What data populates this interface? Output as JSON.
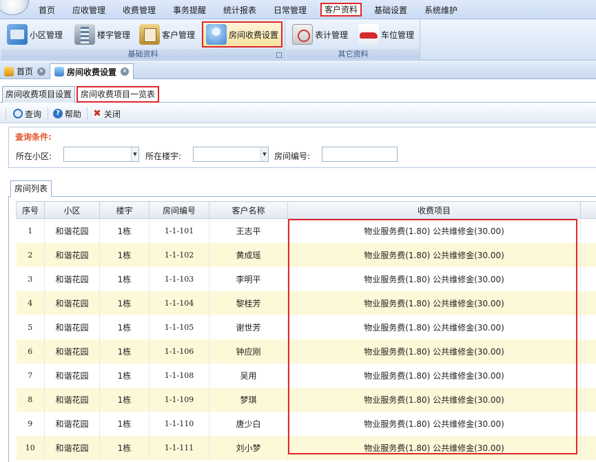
{
  "menubar": {
    "items": [
      {
        "label": "首页",
        "active": false
      },
      {
        "label": "应收管理",
        "active": false
      },
      {
        "label": "收费管理",
        "active": false
      },
      {
        "label": "事务提醒",
        "active": false
      },
      {
        "label": "统计报表",
        "active": false
      },
      {
        "label": "日常管理",
        "active": false
      },
      {
        "label": "客户资料",
        "active": true
      },
      {
        "label": "基础设置",
        "active": false
      },
      {
        "label": "系统维护",
        "active": false
      }
    ]
  },
  "ribbon": {
    "groups": [
      {
        "label": "基础资料",
        "buttons": [
          {
            "label": "小区管理",
            "icon": "community-icon"
          },
          {
            "label": "楼宇管理",
            "icon": "building-icon"
          },
          {
            "label": "客户管理",
            "icon": "customer-icon"
          },
          {
            "label": "房间收费设置",
            "icon": "room-fee-icon",
            "highlighted": true
          }
        ]
      },
      {
        "label": "其它资料",
        "buttons": [
          {
            "label": "表计管理",
            "icon": "meter-icon"
          },
          {
            "label": "车位管理",
            "icon": "car-icon"
          }
        ]
      }
    ]
  },
  "doctabs": [
    {
      "label": "首页",
      "icon": "home-icon",
      "selected": false
    },
    {
      "label": "房间收费设置",
      "icon": "room-fee-icon",
      "selected": true
    }
  ],
  "subtabs": [
    {
      "label": "房间收费项目设置",
      "selected": false
    },
    {
      "label": "房间收费项目一览表",
      "selected": true
    }
  ],
  "toolbar": {
    "query_label": "查询",
    "help_label": "帮助",
    "close_label": "关闭"
  },
  "query": {
    "title": "查询条件:",
    "community_label": "所在小区:",
    "building_label": "所在楼宇:",
    "room_label": "房间编号:",
    "community_value": "",
    "building_value": "",
    "room_value": ""
  },
  "grid": {
    "tab_label": "房间列表",
    "columns": [
      "序号",
      "小区",
      "楼宇",
      "房间编号",
      "客户名称",
      "收费项目"
    ],
    "rows": [
      [
        "1",
        "和谐花园",
        "1栋",
        "1-1-101",
        "王志平",
        "物业服务费(1.80) 公共维修金(30.00)"
      ],
      [
        "2",
        "和谐花园",
        "1栋",
        "1-1-102",
        "黄成瑶",
        "物业服务费(1.80) 公共维修金(30.00)"
      ],
      [
        "3",
        "和谐花园",
        "1栋",
        "1-1-103",
        "李明平",
        "物业服务费(1.80) 公共维修金(30.00)"
      ],
      [
        "4",
        "和谐花园",
        "1栋",
        "1-1-104",
        "黎桂芳",
        "物业服务费(1.80) 公共维修金(30.00)"
      ],
      [
        "5",
        "和谐花园",
        "1栋",
        "1-1-105",
        "谢世芳",
        "物业服务费(1.80) 公共维修金(30.00)"
      ],
      [
        "6",
        "和谐花园",
        "1栋",
        "1-1-106",
        "钟应刚",
        "物业服务费(1.80) 公共维修金(30.00)"
      ],
      [
        "7",
        "和谐花园",
        "1栋",
        "1-1-108",
        "吴用",
        "物业服务费(1.80) 公共维修金(30.00)"
      ],
      [
        "8",
        "和谐花园",
        "1栋",
        "1-1-109",
        "梦琪",
        "物业服务费(1.80) 公共维修金(30.00)"
      ],
      [
        "9",
        "和谐花园",
        "1栋",
        "1-1-110",
        "唐少白",
        "物业服务费(1.80) 公共维修金(30.00)"
      ],
      [
        "10",
        "和谐花园",
        "1栋",
        "1-1-111",
        "刘小梦",
        "物业服务费(1.80) 公共维修金(30.00)"
      ]
    ]
  },
  "colors": {
    "highlight": "#e0262a",
    "alt_row": "#fdf8d8",
    "query_title": "#e2562c"
  }
}
